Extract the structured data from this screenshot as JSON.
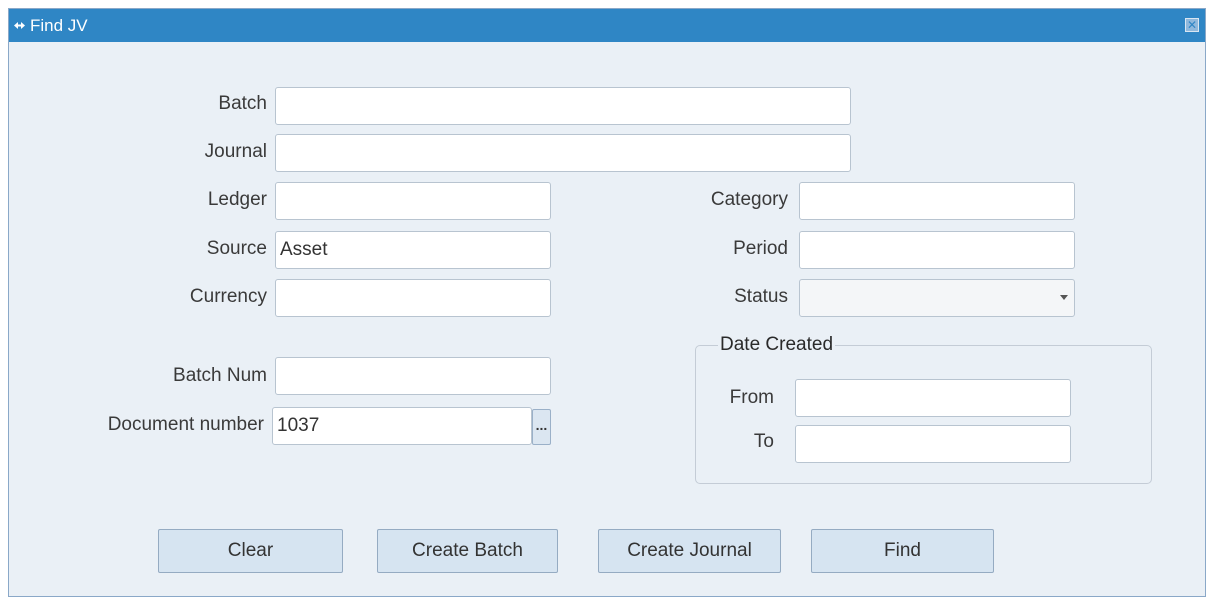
{
  "window": {
    "title": "Find JV",
    "close_glyph": "✕"
  },
  "fields": {
    "batch": {
      "label": "Batch",
      "value": ""
    },
    "journal": {
      "label": "Journal",
      "value": ""
    },
    "ledger": {
      "label": "Ledger",
      "value": ""
    },
    "source": {
      "label": "Source",
      "value": "Asset"
    },
    "currency": {
      "label": "Currency",
      "value": ""
    },
    "category": {
      "label": "Category",
      "value": ""
    },
    "period": {
      "label": "Period",
      "value": ""
    },
    "status": {
      "label": "Status",
      "value": ""
    },
    "batch_num": {
      "label": "Batch Num",
      "value": ""
    },
    "document_number": {
      "label": "Document number",
      "value": "1037",
      "lov_glyph": "..."
    }
  },
  "date_created": {
    "title": "Date Created",
    "from": {
      "label": "From",
      "value": ""
    },
    "to": {
      "label": "To",
      "value": ""
    }
  },
  "buttons": {
    "clear": "Clear",
    "create_batch": "Create Batch",
    "create_journal": "Create Journal",
    "find": "Find"
  },
  "colors": {
    "titlebar": "#2f86c5",
    "window_bg": "#eaf0f6",
    "button_bg": "#d6e4f1"
  },
  "icons": {
    "title_icon": "window-menu-icon",
    "close_icon": "close-icon",
    "dropdown_icon": "chevron-down-icon"
  }
}
